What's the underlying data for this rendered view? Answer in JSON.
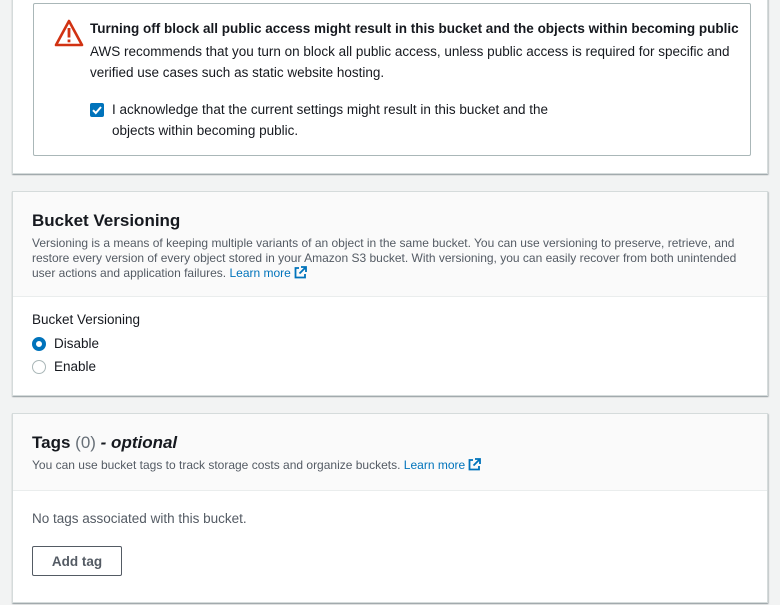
{
  "access_warning": {
    "title": "Turning off block all public access might result in this bucket and the objects within becoming public",
    "body": "AWS recommends that you turn on block all public access, unless public access is required for specific and verified use cases such as static website hosting.",
    "acknowledge_checked": true,
    "acknowledge_label": "I acknowledge that the current settings might result in this bucket and the objects within becoming public."
  },
  "versioning": {
    "title": "Bucket Versioning",
    "description": "Versioning is a means of keeping multiple variants of an object in the same bucket. You can use versioning to preserve, retrieve, and restore every version of every object stored in your Amazon S3 bucket. With versioning, you can easily recover from both unintended user actions and application failures.",
    "learn_more": "Learn more",
    "field_label": "Bucket Versioning",
    "options": [
      {
        "label": "Disable",
        "selected": true
      },
      {
        "label": "Enable",
        "selected": false
      }
    ]
  },
  "tags": {
    "title": "Tags",
    "count": "(0)",
    "optional": "- optional",
    "description": "You can use bucket tags to track storage costs and organize buckets.",
    "learn_more": "Learn more",
    "empty_text": "No tags associated with this bucket.",
    "add_button": "Add tag"
  },
  "colors": {
    "accent": "#0073bb",
    "warning": "#d13212",
    "text": "#16191f",
    "secondary_text": "#545b64"
  }
}
